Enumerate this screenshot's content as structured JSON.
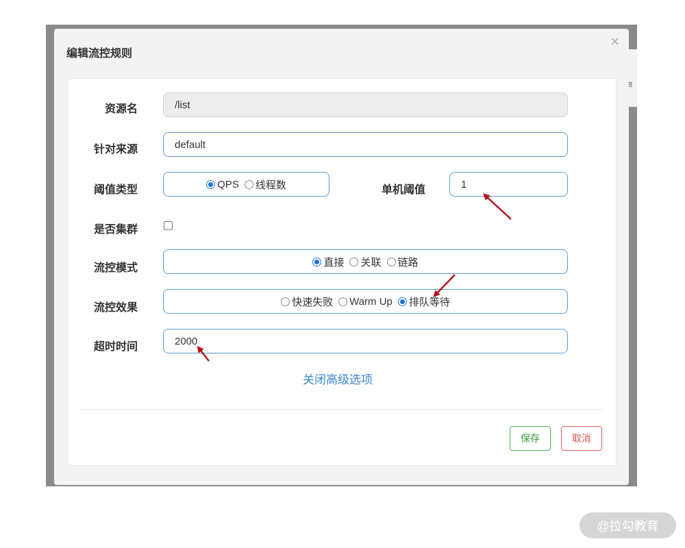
{
  "modal": {
    "title": "编辑流控规则",
    "close_glyph": "×"
  },
  "background_peek_text": "8",
  "form": {
    "resource_label": "资源名",
    "resource_value": "/list",
    "source_label": "针对来源",
    "source_value": "default",
    "threshold_type_label": "阈值类型",
    "threshold_type_options": [
      "QPS",
      "线程数"
    ],
    "threshold_type_selected": "QPS",
    "single_threshold_label": "单机阈值",
    "single_threshold_value": "1",
    "cluster_label": "是否集群",
    "cluster_checked": false,
    "mode_label": "流控模式",
    "mode_options": [
      "直接",
      "关联",
      "链路"
    ],
    "mode_selected": "直接",
    "effect_label": "流控效果",
    "effect_options": [
      "快速失败",
      "Warm Up",
      "排队等待"
    ],
    "effect_selected": "排队等待",
    "timeout_label": "超时时间",
    "timeout_value": "2000",
    "advanced_link": "关闭高级选项"
  },
  "buttons": {
    "save": "保存",
    "cancel": "取消"
  },
  "colors": {
    "accent_blue": "#5b9bd5",
    "radio_blue": "#1a73e8",
    "link_blue": "#3b86d3",
    "save_green": "#4cae4c",
    "cancel_red": "#d9534f",
    "arrow_red": "#b3141b"
  },
  "watermark": "@拉勾教育"
}
